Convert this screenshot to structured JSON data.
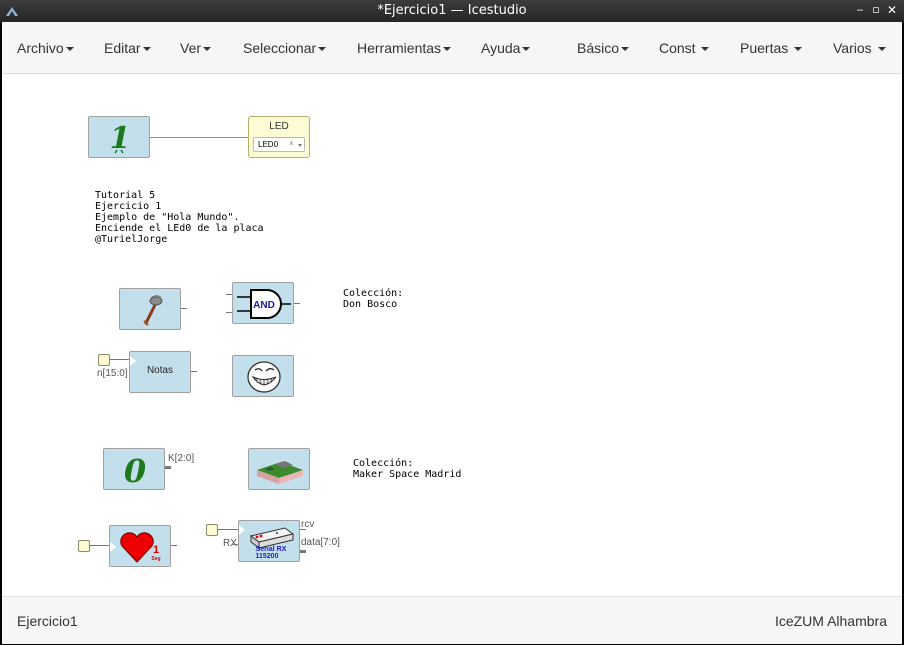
{
  "window": {
    "title": "*Ejercicio1 — Icestudio",
    "controls": [
      "minimize",
      "maximize",
      "close"
    ]
  },
  "menubar": {
    "items": [
      {
        "label": "Archivo"
      },
      {
        "label": "Editar"
      },
      {
        "label": "Ver"
      },
      {
        "label": "Seleccionar"
      },
      {
        "label": "Herramientas"
      },
      {
        "label": "Ayuda"
      },
      {
        "label": "Básico"
      },
      {
        "label": "Const"
      },
      {
        "label": "Puertas"
      },
      {
        "label": "Varios"
      }
    ]
  },
  "canvas": {
    "led_block": {
      "header": "LED",
      "select_value": "LED0",
      "clear_symbol": "×"
    },
    "comment_1": "Tutorial 5\nEjercicio 1\nEjemplo de \"Hola Mundo\".\nEnciende el LEd0 de la placa\n@TurielJorge",
    "constant_one": "1",
    "and_gate_label": "AND",
    "collection_1": "Colección:\nDon Bosco",
    "notes_block": {
      "label": "Notas",
      "port_label": "n[15:0]"
    },
    "constant_zero": {
      "value": "0",
      "port_label": "K[2:0]"
    },
    "collection_2": "Colección:\nMaker Space Madrid",
    "heart_block": {
      "digit": "1",
      "unit": "Seg"
    },
    "serial_block": {
      "line1": "Serial RX",
      "line2": "115200",
      "in_label": "RX",
      "out_label_1": "rcv",
      "out_label_2": "data[7:0]"
    }
  },
  "footer": {
    "left": "Ejercicio1",
    "right": "IceZUM Alhambra"
  },
  "colors": {
    "block_fill": "#c3dfeb",
    "led_fill": "#fdfbd3",
    "titlebar": "#2e2e2e",
    "constant_green": "#1c7a1c"
  }
}
